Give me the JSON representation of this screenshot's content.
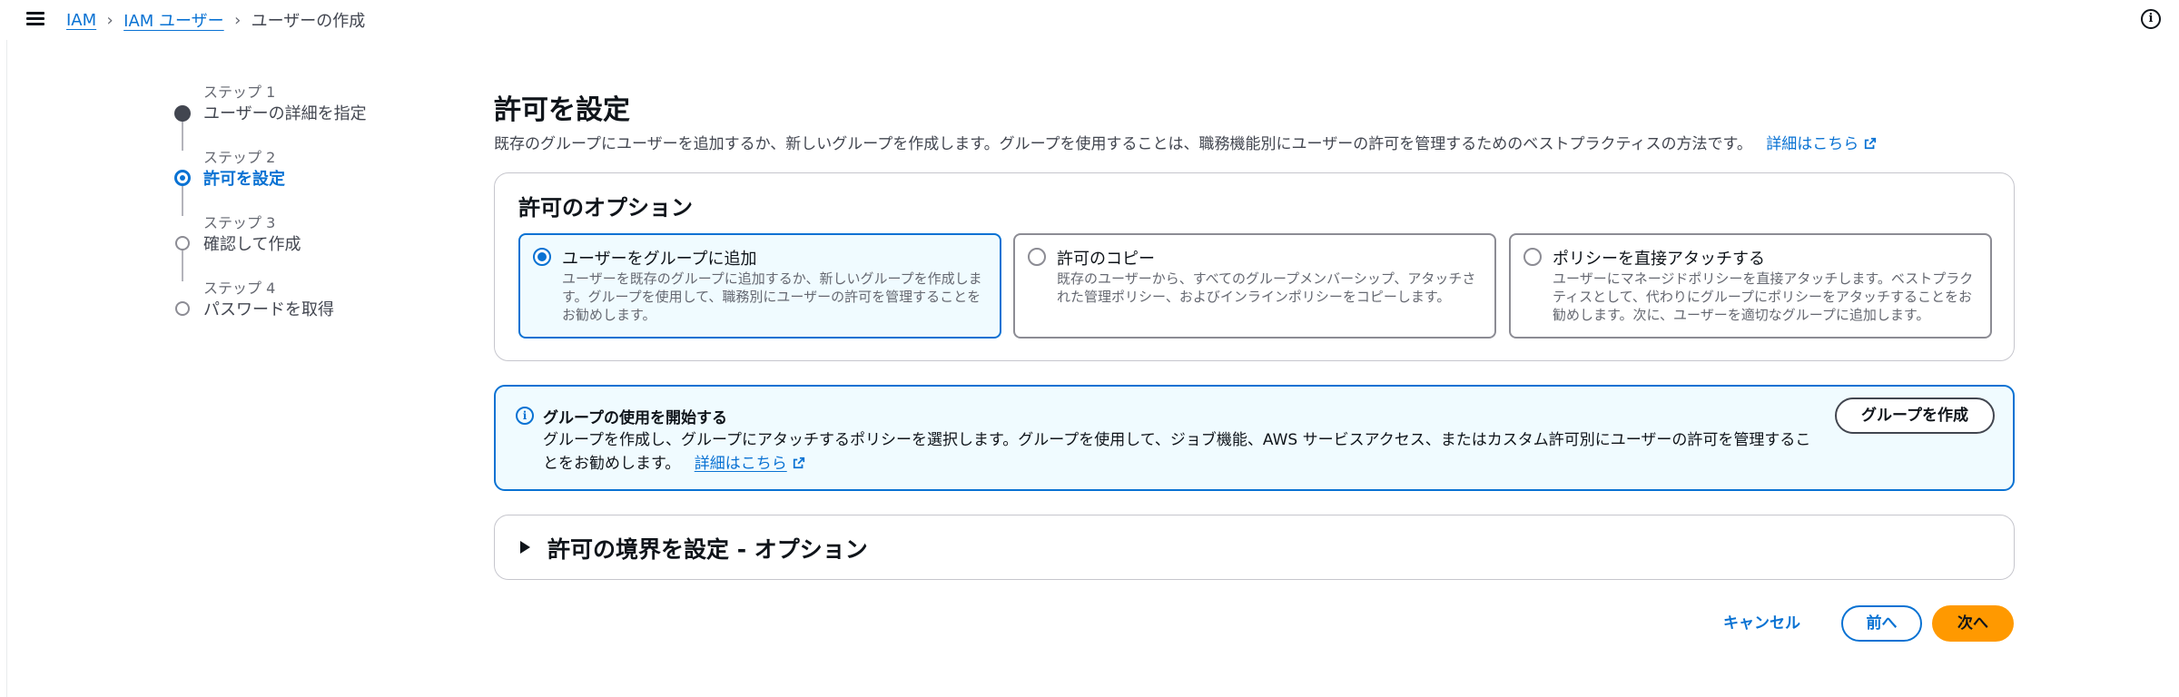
{
  "breadcrumb": {
    "items": [
      "IAM",
      "IAM ユーザー"
    ],
    "current": "ユーザーの作成"
  },
  "stepper": {
    "steps": [
      {
        "label": "ステップ 1",
        "title": "ユーザーの詳細を指定",
        "state": "done"
      },
      {
        "label": "ステップ 2",
        "title": "許可を設定",
        "state": "active"
      },
      {
        "label": "ステップ 3",
        "title": "確認して作成",
        "state": "todo"
      },
      {
        "label": "ステップ 4",
        "title": "パスワードを取得",
        "state": "todo"
      }
    ]
  },
  "main": {
    "title": "許可を設定",
    "description": "既存のグループにユーザーを追加するか、新しいグループを作成します。グループを使用することは、職務機能別にユーザーの許可を管理するためのベストプラクティスの方法です。",
    "learn_more": "詳細はこちら"
  },
  "options": {
    "title": "許可のオプション",
    "tiles": [
      {
        "title": "ユーザーをグループに追加",
        "desc": "ユーザーを既存のグループに追加するか、新しいグループを作成します。グループを使用して、職務別にユーザーの許可を管理することをお勧めします。",
        "selected": true
      },
      {
        "title": "許可のコピー",
        "desc": "既存のユーザーから、すべてのグループメンバーシップ、アタッチされた管理ポリシー、およびインラインポリシーをコピーします。",
        "selected": false
      },
      {
        "title": "ポリシーを直接アタッチする",
        "desc": "ユーザーにマネージドポリシーを直接アタッチします。ベストプラクティスとして、代わりにグループにポリシーをアタッチすることをお勧めします。次に、ユーザーを適切なグループに追加します。",
        "selected": false
      }
    ]
  },
  "alert": {
    "title": "グループの使用を開始する",
    "text": "グループを作成し、グループにアタッチするポリシーを選択します。グループを使用して、ジョブ機能、AWS サービスアクセス、またはカスタム許可別にユーザーの許可を管理することをお勧めします。",
    "learn_more": "詳細はこちら",
    "button": "グループを作成"
  },
  "boundary": {
    "title": "許可の境界を設定 - オプション"
  },
  "footer": {
    "cancel": "キャンセル",
    "previous": "前へ",
    "next": "次へ"
  },
  "colors": {
    "link": "#0972d3",
    "primary_button": "#ff9900",
    "alert_bg": "#f0fbff"
  },
  "icons": [
    "menu-icon",
    "info-icon",
    "chevron-right-icon",
    "external-link-icon",
    "caret-right-icon"
  ]
}
